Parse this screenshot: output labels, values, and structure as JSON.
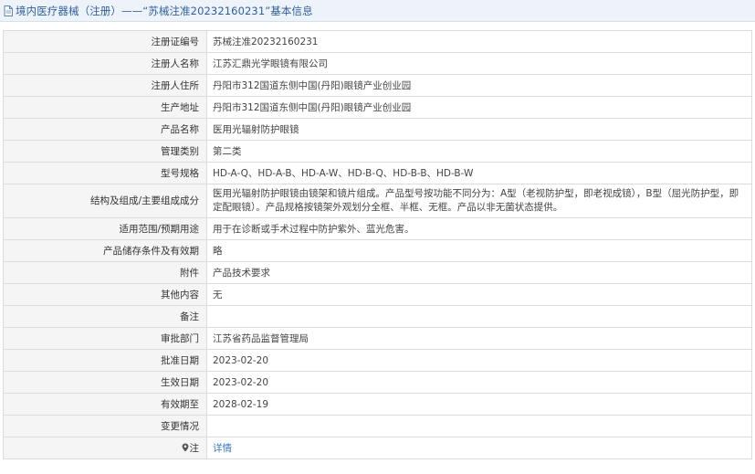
{
  "header": {
    "title": "境内医疗器械（注册）——“苏械注准20232160231”基本信息",
    "icon": "document-icon"
  },
  "rows": [
    {
      "label": "注册证编号",
      "value": "苏械注准20232160231"
    },
    {
      "label": "注册人名称",
      "value": "江苏汇鼎光学眼镜有限公司"
    },
    {
      "label": "注册人住所",
      "value": "丹阳市312国道东侧中国(丹阳)眼镜产业创业园"
    },
    {
      "label": "生产地址",
      "value": "丹阳市312国道东侧中国(丹阳)眼镜产业创业园"
    },
    {
      "label": "产品名称",
      "value": "医用光辐射防护眼镜"
    },
    {
      "label": "管理类别",
      "value": "第二类"
    },
    {
      "label": "型号规格",
      "value": "HD-A-Q、HD-A-B、HD-A-W、HD-B-Q、HD-B-B、HD-B-W"
    },
    {
      "label": "结构及组成/主要组成成分",
      "value": "医用光辐射防护眼镜由镜架和镜片组成。产品型号按功能不同分为：A型（老视防护型，即老视成镜），B型（屈光防护型，即定配眼镜）。产品规格按镜架外观划分全框、半框、无框。产品以非无菌状态提供。"
    },
    {
      "label": "适用范围/预期用途",
      "value": "用于在诊断或手术过程中防护紫外、蓝光危害。"
    },
    {
      "label": "产品储存条件及有效期",
      "value": "略"
    },
    {
      "label": "附件",
      "value": "产品技术要求"
    },
    {
      "label": "其他内容",
      "value": "无"
    },
    {
      "label": "备注",
      "value": ""
    },
    {
      "label": "审批部门",
      "value": "江苏省药品监督管理局"
    },
    {
      "label": "批准日期",
      "value": "2023-02-20"
    },
    {
      "label": "生效日期",
      "value": "2023-02-20"
    },
    {
      "label": "有效期至",
      "value": "2028-02-19"
    },
    {
      "label": "变更情况",
      "value": ""
    },
    {
      "label": "注",
      "value": "详情"
    }
  ],
  "colors": {
    "header_bg": "#eef3f9",
    "header_text": "#2e5f9f",
    "label_bg": "#f5f5f5",
    "border": "#dcdcdc",
    "link": "#3b78c9"
  }
}
